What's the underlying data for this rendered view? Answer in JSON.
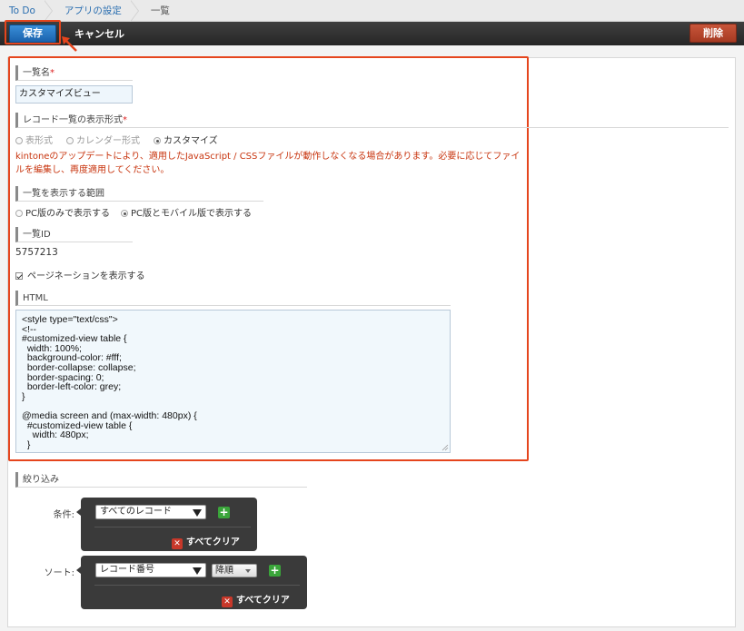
{
  "breadcrumb": {
    "items": [
      "To Do",
      "アプリの設定",
      "一覧"
    ]
  },
  "toolbar": {
    "save": "保存",
    "cancel": "キャンセル",
    "delete": "削除"
  },
  "form": {
    "name_label": "一覧名",
    "required_mark": "*",
    "name_value": "カスタマイズビュー",
    "format_label": "レコード一覧の表示形式",
    "format_options": [
      "表形式",
      "カレンダー形式",
      "カスタマイズ"
    ],
    "format_selected": "カスタマイズ",
    "warning": "kintoneのアップデートにより、適用したJavaScript / CSSファイルが動作しなくなる場合があります。必要に応じてファイルを編集し、再度適用してください。",
    "scope_label": "一覧を表示する範囲",
    "scope_options": [
      "PC版のみで表示する",
      "PC版とモバイル版で表示する"
    ],
    "scope_selected": "PC版とモバイル版で表示する",
    "id_label": "一覧ID",
    "id_value": "5757213",
    "pagination_label": "ページネーションを表示する",
    "pagination_checked": true,
    "html_label": "HTML",
    "html_code": "<style type=\"text/css\">\n<!--\n#customized-view table {\n  width: 100%;\n  background-color: #fff;\n  border-collapse: collapse;\n  border-spacing: 0;\n  border-left-color: grey;\n}\n\n@media screen and (max-width: 480px) {\n  #customized-view table {\n    width: 480px;\n  }"
  },
  "filter": {
    "section_label": "絞り込み",
    "condition_label": "条件:",
    "condition_value": "すべてのレコード",
    "sort_label": "ソート:",
    "sort_field": "レコード番号",
    "sort_order": "降順",
    "clear_all": "すべてクリア",
    "plus": "+",
    "x": "✕"
  },
  "colors": {
    "highlight": "#e5451d",
    "save_blue": "#1a62ad",
    "delete_red": "#a63a22",
    "warn": "#c8350f"
  }
}
